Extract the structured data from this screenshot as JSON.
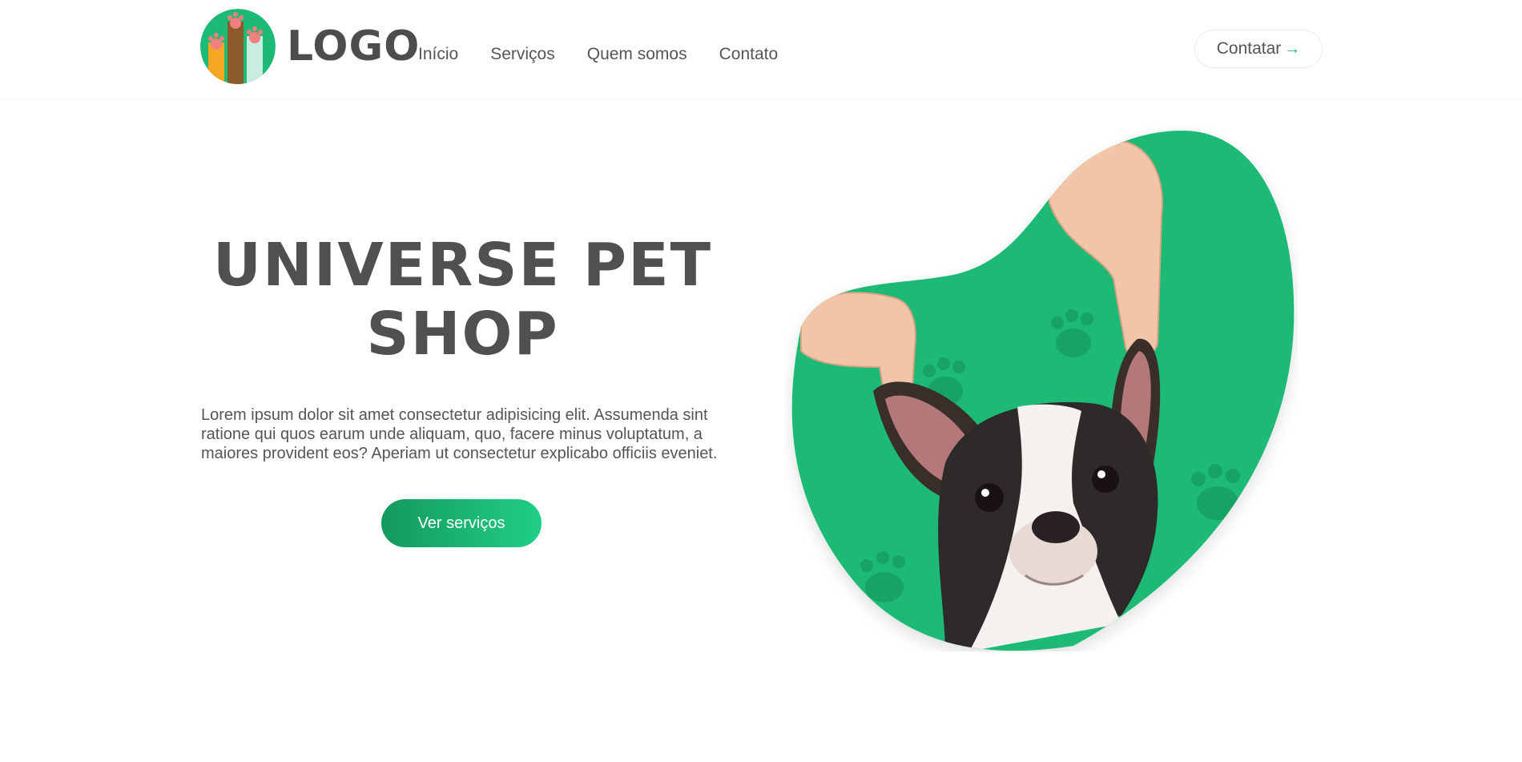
{
  "header": {
    "logo_text": "LOGO",
    "nav": [
      {
        "label": "Início"
      },
      {
        "label": "Serviços"
      },
      {
        "label": "Quem somos"
      },
      {
        "label": "Contato"
      }
    ],
    "contact_label": "Contatar",
    "contact_arrow": "→"
  },
  "hero": {
    "title_line1": "UNIVERSE PET",
    "title_line2": "SHOP",
    "description": "Lorem ipsum dolor sit amet consectetur adipisicing elit. Assumenda sint ratione qui quos earum unde aliquam, quo, facere minus voluptatum, a maiores provident eos? Aperiam ut consectetur explicabo officiis eveniet.",
    "cta_label": "Ver serviços"
  },
  "colors": {
    "brand_green": "#1dba75",
    "text_dark": "#555555"
  },
  "icons": [
    "paw-logo-icon",
    "arrow-right-icon",
    "paw-print-icon"
  ]
}
